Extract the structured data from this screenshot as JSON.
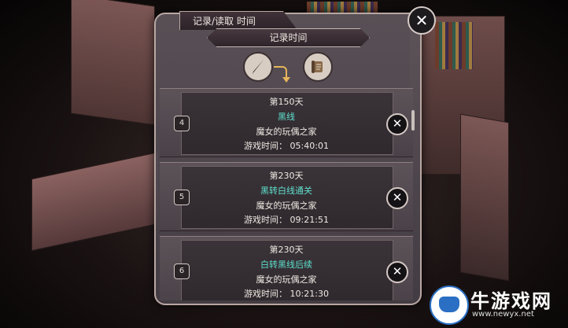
{
  "header": {
    "title": "记录/读取 时间"
  },
  "subheader": {
    "title": "记录时间"
  },
  "tools": {
    "pen_icon": "quill-pen-icon",
    "scroll_icon": "scroll-icon"
  },
  "close_label": "✕",
  "slots": [
    {
      "number": "4",
      "day": "第150天",
      "route": "黑线",
      "game_name": "魔女的玩偶之家",
      "play_time": "游戏时间：  05:40:01",
      "delete": "✕"
    },
    {
      "number": "5",
      "day": "第230天",
      "route": "黑转白线通关",
      "game_name": "魔女的玩偶之家",
      "play_time": "游戏时间：  09:21:51",
      "delete": "✕"
    },
    {
      "number": "6",
      "day": "第230天",
      "route": "白转黑线后续",
      "game_name": "魔女的玩偶之家",
      "play_time": "游戏时间：  10:21:30",
      "delete": "✕"
    }
  ],
  "watermark": {
    "name": "牛游戏网",
    "url": "www.newyx.net"
  },
  "colors": {
    "route_text": "#5fe0cd",
    "arrow": "#e6b45c"
  }
}
